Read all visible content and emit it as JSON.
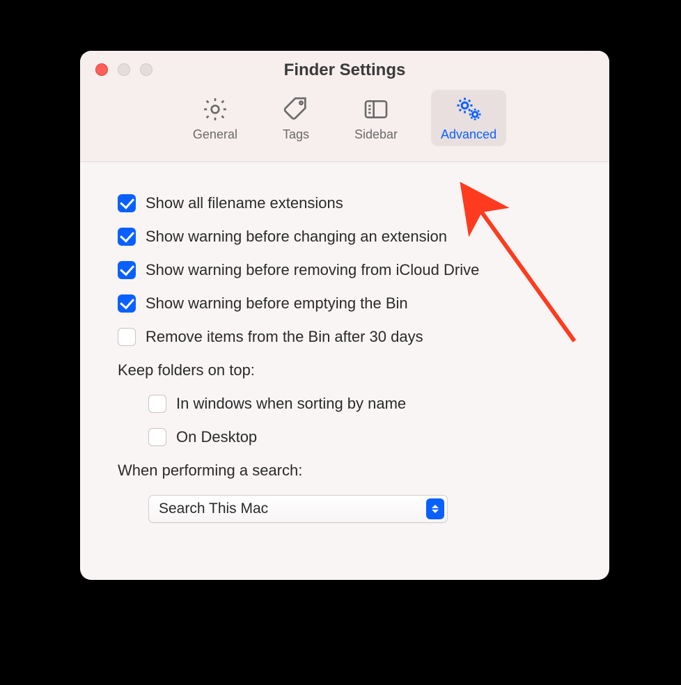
{
  "window": {
    "title": "Finder Settings"
  },
  "toolbar": {
    "general": "General",
    "tags": "Tags",
    "sidebar": "Sidebar",
    "advanced": "Advanced",
    "selected": "advanced"
  },
  "options": {
    "show_ext": {
      "label": "Show all filename extensions",
      "checked": true
    },
    "warn_ext": {
      "label": "Show warning before changing an extension",
      "checked": true
    },
    "warn_icloud": {
      "label": "Show warning before removing from iCloud Drive",
      "checked": true
    },
    "warn_bin": {
      "label": "Show warning before emptying the Bin",
      "checked": true
    },
    "remove_30": {
      "label": "Remove items from the Bin after 30 days",
      "checked": false
    }
  },
  "folders": {
    "heading": "Keep folders on top:",
    "sort_name": {
      "label": "In windows when sorting by name",
      "checked": false
    },
    "desktop": {
      "label": "On Desktop",
      "checked": false
    }
  },
  "search": {
    "heading": "When performing a search:",
    "selected": "Search This Mac"
  },
  "colors": {
    "accent": "#0a60ff"
  }
}
